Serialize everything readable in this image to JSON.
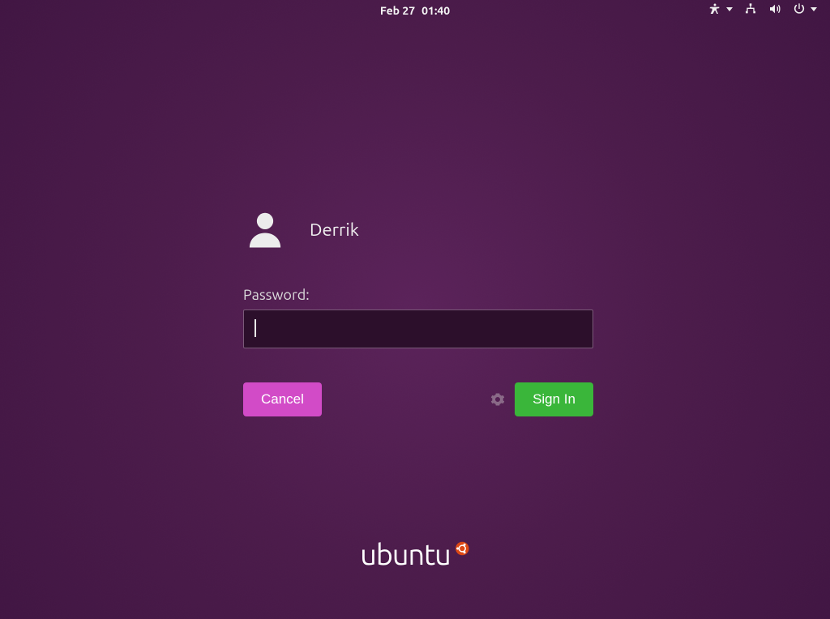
{
  "topbar": {
    "date": "Feb 27",
    "time": "01:40"
  },
  "login": {
    "username": "Derrik",
    "password_label": "Password:",
    "password_value": "",
    "cancel_label": "Cancel",
    "signin_label": "Sign In"
  },
  "branding": {
    "text": "ubuntu"
  },
  "icons": {
    "accessibility": "accessibility-icon",
    "network": "network-icon",
    "sound": "sound-icon",
    "power": "power-icon",
    "gear": "gear-icon",
    "avatar": "user-avatar-icon"
  }
}
